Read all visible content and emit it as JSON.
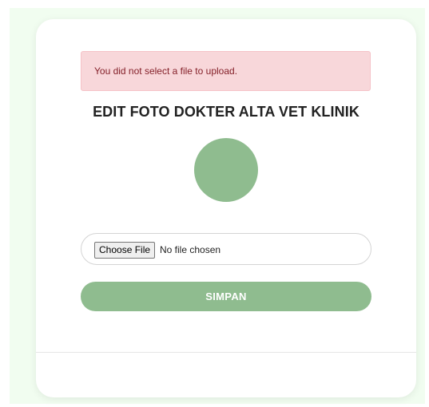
{
  "alert": {
    "message": "You did not select a file to upload."
  },
  "form": {
    "title": "EDIT FOTO DOKTER ALTA VET KLINIK",
    "file_input": {
      "button_label": "Choose File",
      "status": "No file chosen"
    },
    "submit_label": "SIMPAN"
  },
  "colors": {
    "accent": "#8fbc8f",
    "alert_bg": "#f8d7da",
    "alert_text": "#842029",
    "page_bg": "#f1fdf0"
  }
}
